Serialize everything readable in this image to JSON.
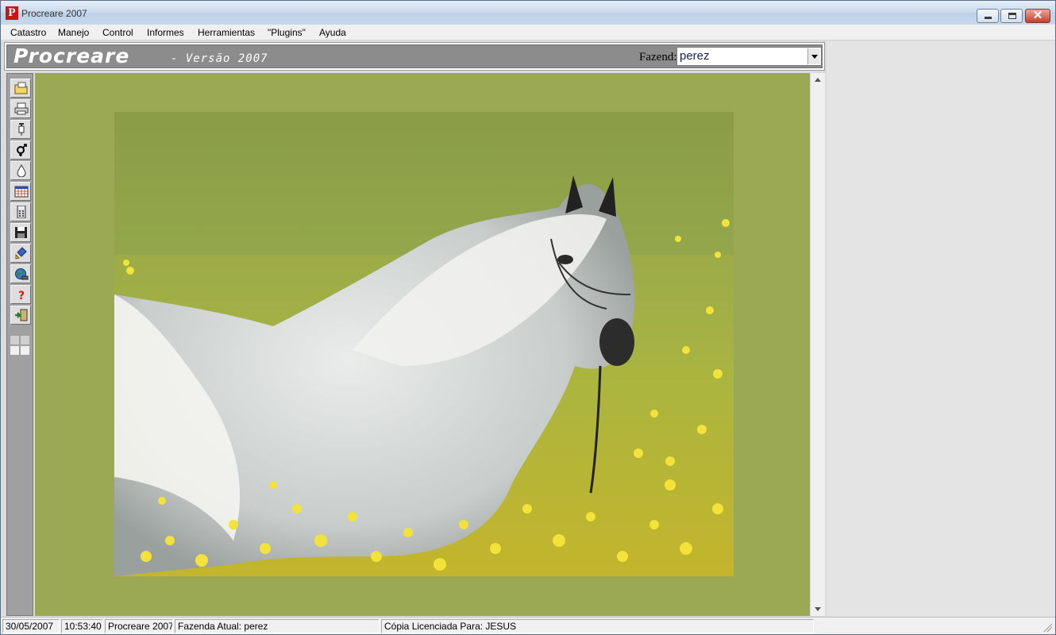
{
  "window": {
    "title": "Procreare 2007",
    "logo_letter": "P"
  },
  "menu": [
    "Catastro",
    "Manejo",
    "Control",
    "Informes",
    "Herramientas",
    "\"Plugins\"",
    "Ayuda"
  ],
  "banner": {
    "brand": "Procreare",
    "version": "- Versão 2007",
    "farm_label": "Fazend:",
    "farm_value": "perez"
  },
  "toolbar": {
    "buttons": [
      "open-folder-icon",
      "printer-icon",
      "syringe-icon",
      "gender-icon",
      "drop-icon",
      "calendar-icon",
      "calculator-icon",
      "save-disk-icon",
      "broom-icon",
      "globe-icon",
      "help-question-icon",
      "exit-icon"
    ]
  },
  "status": {
    "date": "30/05/2007",
    "time": "10:53:40",
    "app": "Procreare 2007",
    "farm": "Fazenda Atual: perez",
    "license": "Cópia Licenciada Para: JESUS"
  },
  "colors": {
    "panel_background": "#9ca954",
    "banner_background": "#8c8c8c",
    "toolbar_background": "#a0a0a0"
  }
}
